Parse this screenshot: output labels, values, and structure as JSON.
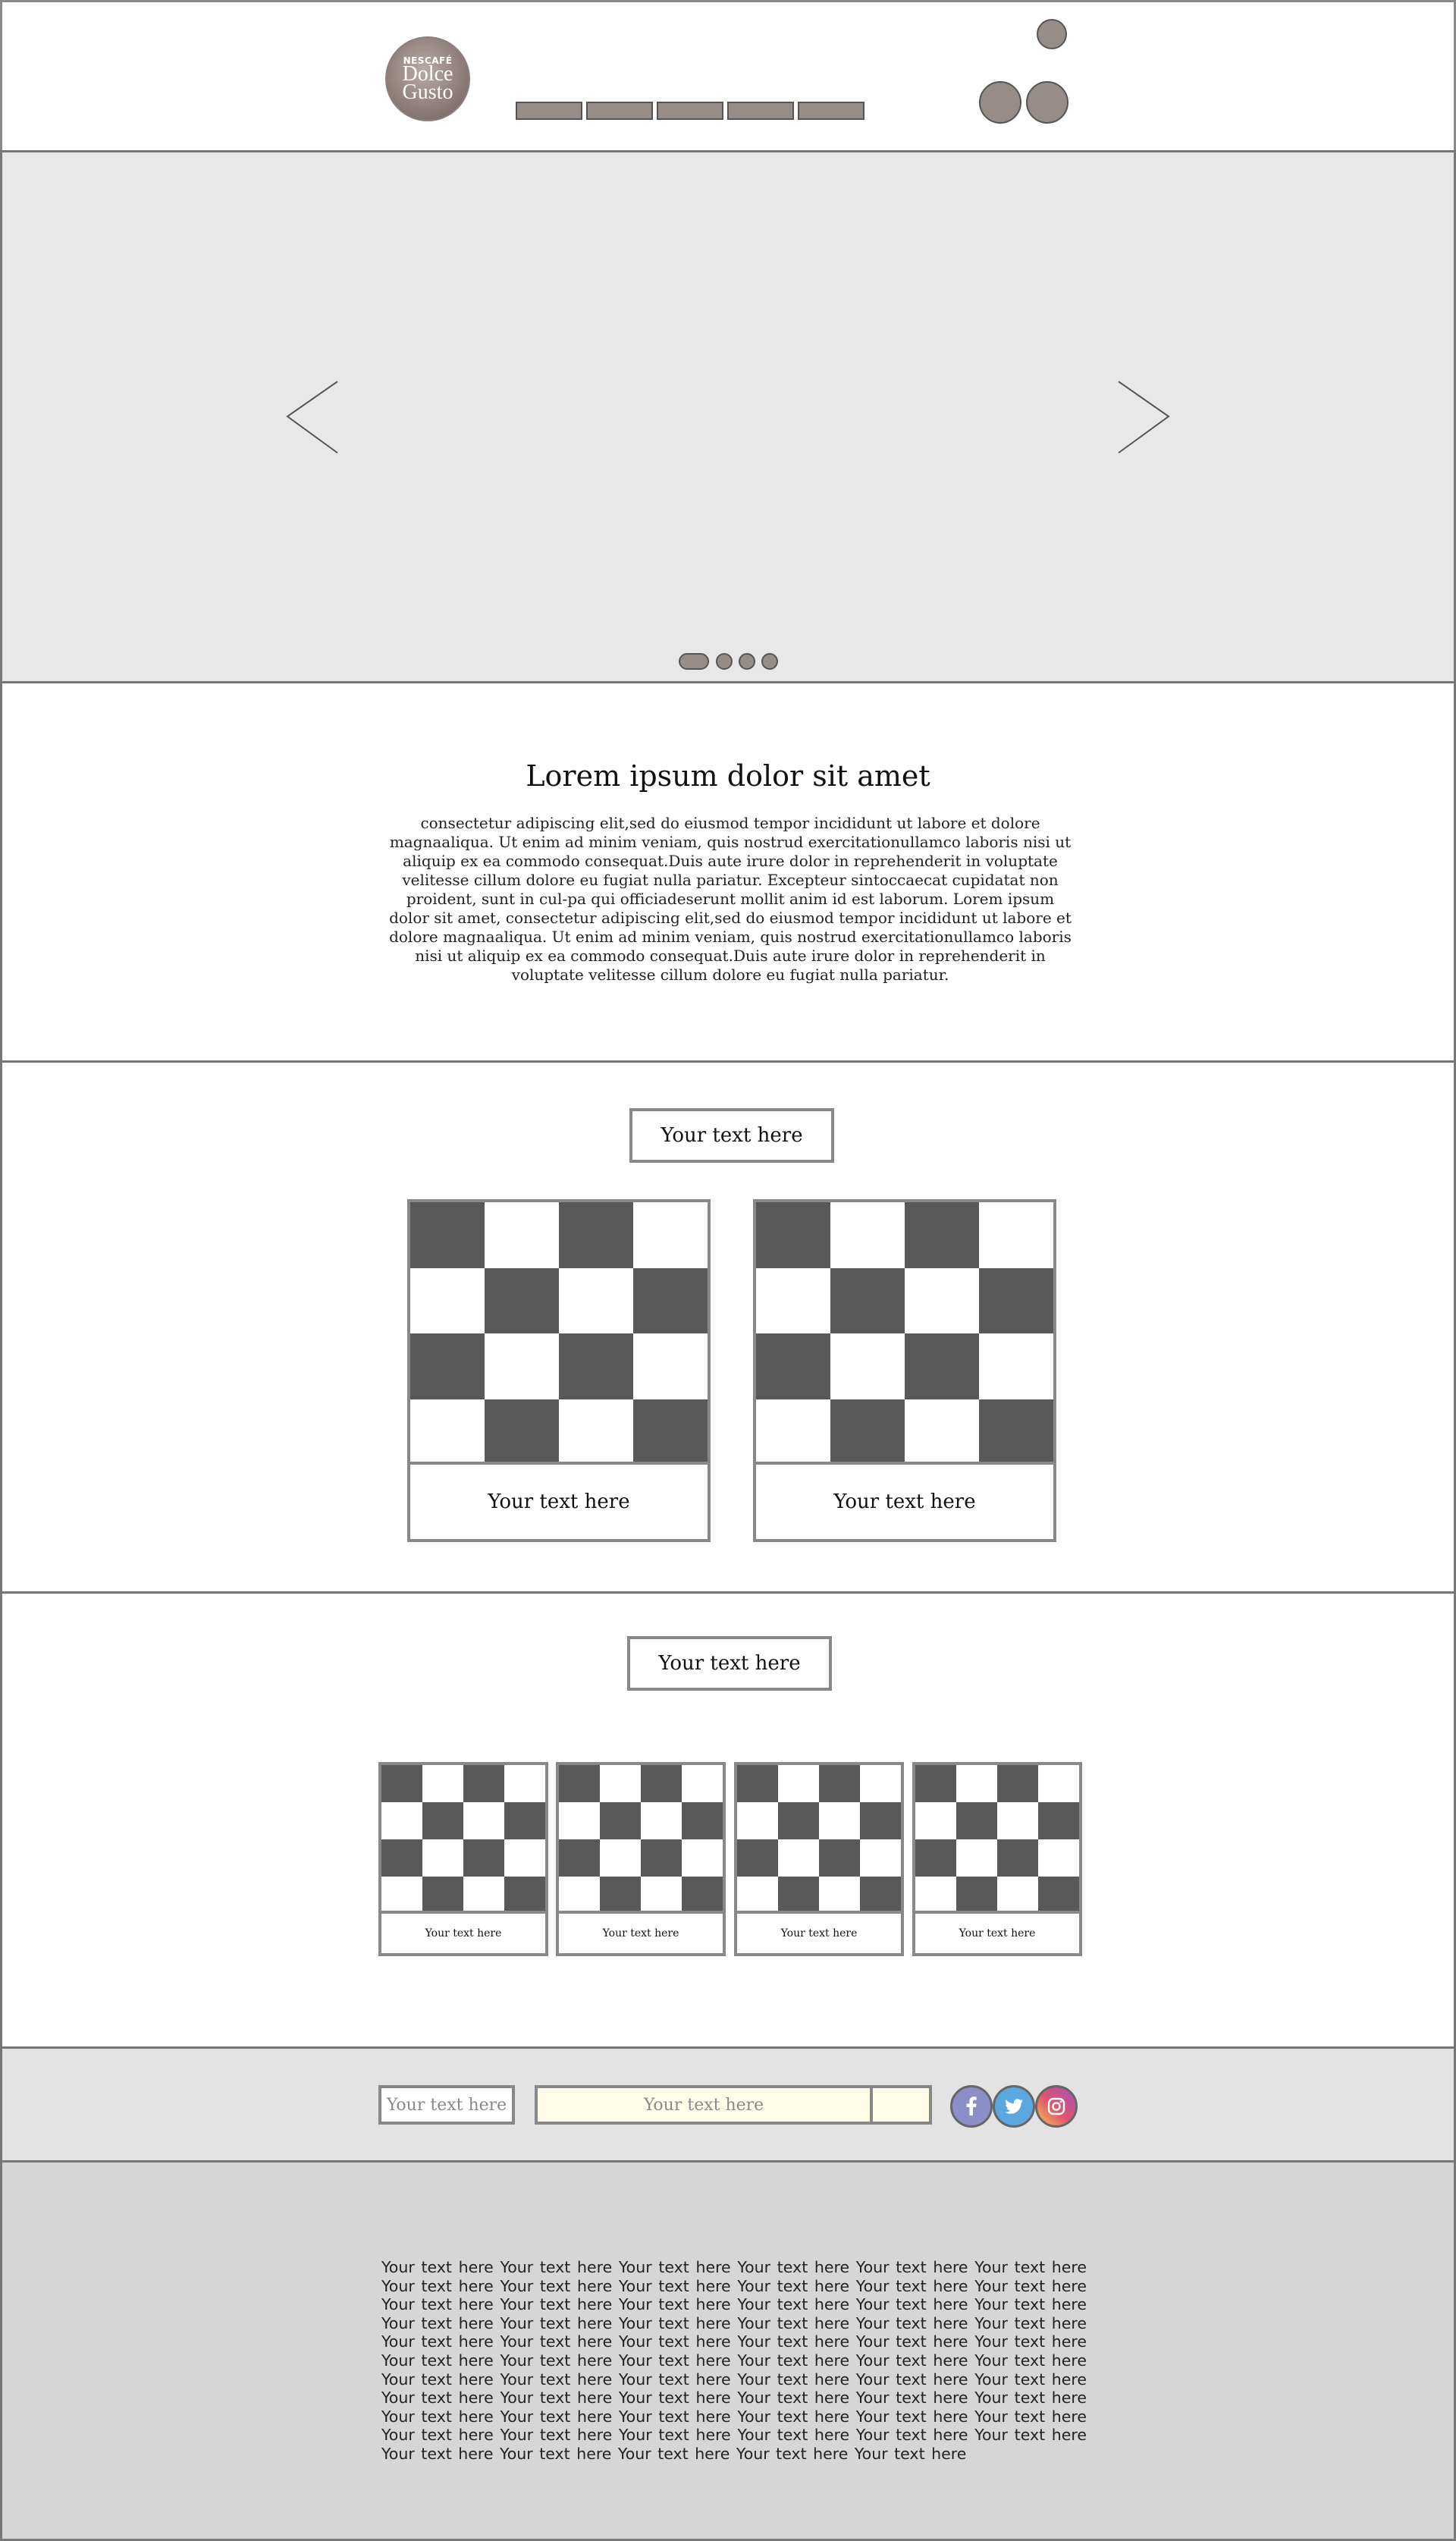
{
  "header": {
    "logo_brand": "NESCAFÉ",
    "logo_name": "Dolce Gusto",
    "nav_items": [
      "",
      "",
      "",
      "",
      ""
    ],
    "icons": [
      "account-icon",
      "search-icon",
      "cart-icon"
    ]
  },
  "hero": {
    "prev_icon": "chevron-left-icon",
    "next_icon": "chevron-right-icon",
    "slides_count": 4,
    "active_slide": 1
  },
  "intro": {
    "title": "Lorem ipsum dolor sit amet",
    "body": "consectetur adipiscing elit,sed do eiusmod tempor incididunt ut labore et dolore magnaaliqua. Ut enim ad minim veniam, quis nostrud exercitationullamco laboris nisi ut aliquip ex ea commodo consequat.Duis aute irure dolor in reprehenderit in voluptate velitesse cillum dolore eu fugiat nulla pariatur. Excepteur sintoccaecat cupidatat non proident, sunt in cul-pa qui officiadeserunt mollit anim id est laborum. Lorem ipsum dolor sit amet, consectetur adipiscing elit,sed do eiusmod tempor incididunt ut labore et dolore magnaaliqua. Ut enim ad minim veniam, quis nostrud exercitationullamco laboris nisi ut aliquip ex ea commodo consequat.Duis aute irure dolor in reprehenderit in voluptate velitesse cillum dolore eu fugiat nulla pariatur."
  },
  "featured": {
    "heading": "Your text here",
    "cards": [
      {
        "label": "Your text here"
      },
      {
        "label": "Your text here"
      }
    ]
  },
  "products": {
    "heading": "Your text here",
    "cards": [
      {
        "label": "Your text here"
      },
      {
        "label": "Your text here"
      },
      {
        "label": "Your text here"
      },
      {
        "label": "Your text here"
      }
    ]
  },
  "newsletter": {
    "label": "Your text here",
    "email_placeholder": "Your text here",
    "submit_label": "",
    "social": [
      "facebook-icon",
      "twitter-icon",
      "instagram-icon"
    ]
  },
  "footer": {
    "text": "Your text here Your text here Your text here Your text here Your text here Your text here Your text here Your text here Your text here Your text here Your text here Your text here Your text here Your text here Your text here Your text here Your text here Your text here Your text here Your text here Your text here Your text here Your text here Your text here Your text here Your text here Your text here Your text here Your text here Your text here Your text here Your text here Your text here Your text here Your text here Your text here Your text here Your text here Your text here Your text here Your text here Your text here Your text here Your text here Your text here Your text here Your text here Your text here Your text here Your text here Your text here Your text here Your text here Your text here Your text here Your text here Your text here Your text here Your text here Your text here Your text here Your text here Your text here Your text here Your text here"
  },
  "colors": {
    "header_bg": "#ffffff",
    "hero_bg": "#e8e8e8",
    "newsletter_bg": "#e3e3e3",
    "footer_bg": "#d6d6d6",
    "placeholder_fill": "#968d89",
    "checker_dark": "#595959",
    "facebook": "#8c8fc7",
    "twitter": "#5ba8e0"
  }
}
